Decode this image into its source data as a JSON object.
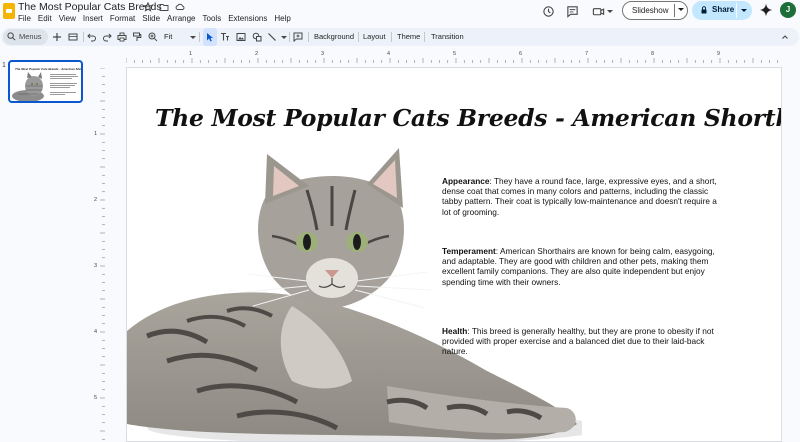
{
  "app": {
    "doc_title": "The Most Popular Cats Breeds",
    "menu": [
      "File",
      "Edit",
      "View",
      "Insert",
      "Format",
      "Slide",
      "Arrange",
      "Tools",
      "Extensions",
      "Help"
    ],
    "slideshow_label": "Slideshow",
    "share_label": "Share",
    "avatar_initial": "J"
  },
  "toolbar": {
    "search_label": "Menus",
    "zoom_label": "Fit",
    "background_label": "Background",
    "layout_label": "Layout",
    "theme_label": "Theme",
    "transition_label": "Transition"
  },
  "filmstrip": {
    "slide_number": "1"
  },
  "rulers": {
    "horizontal_ticks": [
      "1",
      "2",
      "3",
      "4",
      "5",
      "6",
      "7",
      "8",
      "9"
    ],
    "vertical_ticks": [
      "1",
      "2",
      "3",
      "4",
      "5"
    ]
  },
  "slide": {
    "title": "The Most Popular Cats Breeds - American Shorthair",
    "paragraphs": [
      {
        "heading": "Appearance",
        "body": ": They have a round face, large, expressive eyes, and a short, dense coat that comes in many colors and patterns, including the classic tabby pattern. Their coat is typically low-maintenance and doesn't require a lot of grooming."
      },
      {
        "heading": "Temperament",
        "body": ": American Shorthairs are known for being calm, easygoing, and adaptable. They are good with children and other pets, making them excellent family companions. They are also quite independent but enjoy spending time with their owners."
      },
      {
        "heading": "Health",
        "body": ": This breed is generally healthy, but they are prone to obesity if not provided with proper exercise and a balanced diet due to their laid-back nature."
      }
    ]
  },
  "colors": {
    "accent": "#0b57d0",
    "share_bg": "#c2e7ff",
    "toolbar_bg": "#edf2fa",
    "page_bg": "#f8fafd"
  }
}
